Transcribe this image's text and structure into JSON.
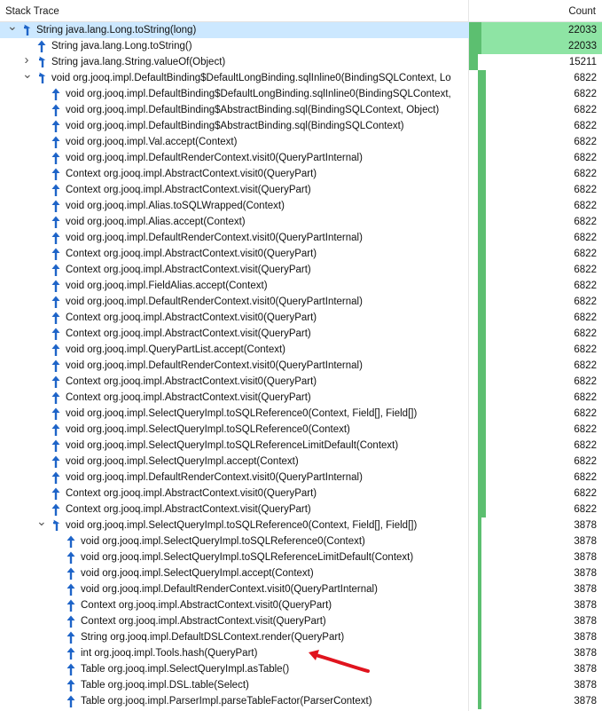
{
  "header": {
    "trace_label": "Stack Trace",
    "count_label": "Count"
  },
  "max_count": 22033,
  "colors": {
    "bar_dark": "#5cbf70",
    "bar_light": "#8ee4a4",
    "selected_row": "#cce8ff",
    "arrow_icon": "#1e64c8",
    "annotation": "#e0141e"
  },
  "rows": [
    {
      "depth": 0,
      "chevron": "down",
      "label": "String java.lang.Long.toString(long)",
      "count": "22033",
      "value": 22033,
      "icon": "arrow-up-left-icon",
      "selected": true
    },
    {
      "depth": 1,
      "chevron": "none",
      "label": "String java.lang.Long.toString()",
      "count": "22033",
      "value": 22033,
      "icon": "arrow-up-icon"
    },
    {
      "depth": 1,
      "chevron": "right",
      "label": "String java.lang.String.valueOf(Object)",
      "count": "15211",
      "value": 15211,
      "icon": "arrow-up-left-icon"
    },
    {
      "depth": 1,
      "chevron": "down",
      "label": "void org.jooq.impl.DefaultBinding$DefaultLongBinding.sqlInline0(BindingSQLContext, Lo",
      "count": "6822",
      "value": 6822,
      "icon": "arrow-up-left-icon"
    },
    {
      "depth": 2,
      "chevron": "none",
      "label": "void org.jooq.impl.DefaultBinding$DefaultLongBinding.sqlInline0(BindingSQLContext,",
      "count": "6822",
      "value": 6822,
      "icon": "arrow-up-icon"
    },
    {
      "depth": 2,
      "chevron": "none",
      "label": "void org.jooq.impl.DefaultBinding$AbstractBinding.sql(BindingSQLContext, Object)",
      "count": "6822",
      "value": 6822,
      "icon": "arrow-up-icon"
    },
    {
      "depth": 2,
      "chevron": "none",
      "label": "void org.jooq.impl.DefaultBinding$AbstractBinding.sql(BindingSQLContext)",
      "count": "6822",
      "value": 6822,
      "icon": "arrow-up-icon"
    },
    {
      "depth": 2,
      "chevron": "none",
      "label": "void org.jooq.impl.Val.accept(Context)",
      "count": "6822",
      "value": 6822,
      "icon": "arrow-up-icon"
    },
    {
      "depth": 2,
      "chevron": "none",
      "label": "void org.jooq.impl.DefaultRenderContext.visit0(QueryPartInternal)",
      "count": "6822",
      "value": 6822,
      "icon": "arrow-up-icon"
    },
    {
      "depth": 2,
      "chevron": "none",
      "label": "Context org.jooq.impl.AbstractContext.visit0(QueryPart)",
      "count": "6822",
      "value": 6822,
      "icon": "arrow-up-icon"
    },
    {
      "depth": 2,
      "chevron": "none",
      "label": "Context org.jooq.impl.AbstractContext.visit(QueryPart)",
      "count": "6822",
      "value": 6822,
      "icon": "arrow-up-icon"
    },
    {
      "depth": 2,
      "chevron": "none",
      "label": "void org.jooq.impl.Alias.toSQLWrapped(Context)",
      "count": "6822",
      "value": 6822,
      "icon": "arrow-up-icon"
    },
    {
      "depth": 2,
      "chevron": "none",
      "label": "void org.jooq.impl.Alias.accept(Context)",
      "count": "6822",
      "value": 6822,
      "icon": "arrow-up-icon"
    },
    {
      "depth": 2,
      "chevron": "none",
      "label": "void org.jooq.impl.DefaultRenderContext.visit0(QueryPartInternal)",
      "count": "6822",
      "value": 6822,
      "icon": "arrow-up-icon"
    },
    {
      "depth": 2,
      "chevron": "none",
      "label": "Context org.jooq.impl.AbstractContext.visit0(QueryPart)",
      "count": "6822",
      "value": 6822,
      "icon": "arrow-up-icon"
    },
    {
      "depth": 2,
      "chevron": "none",
      "label": "Context org.jooq.impl.AbstractContext.visit(QueryPart)",
      "count": "6822",
      "value": 6822,
      "icon": "arrow-up-icon"
    },
    {
      "depth": 2,
      "chevron": "none",
      "label": "void org.jooq.impl.FieldAlias.accept(Context)",
      "count": "6822",
      "value": 6822,
      "icon": "arrow-up-icon"
    },
    {
      "depth": 2,
      "chevron": "none",
      "label": "void org.jooq.impl.DefaultRenderContext.visit0(QueryPartInternal)",
      "count": "6822",
      "value": 6822,
      "icon": "arrow-up-icon"
    },
    {
      "depth": 2,
      "chevron": "none",
      "label": "Context org.jooq.impl.AbstractContext.visit0(QueryPart)",
      "count": "6822",
      "value": 6822,
      "icon": "arrow-up-icon"
    },
    {
      "depth": 2,
      "chevron": "none",
      "label": "Context org.jooq.impl.AbstractContext.visit(QueryPart)",
      "count": "6822",
      "value": 6822,
      "icon": "arrow-up-icon"
    },
    {
      "depth": 2,
      "chevron": "none",
      "label": "void org.jooq.impl.QueryPartList.accept(Context)",
      "count": "6822",
      "value": 6822,
      "icon": "arrow-up-icon"
    },
    {
      "depth": 2,
      "chevron": "none",
      "label": "void org.jooq.impl.DefaultRenderContext.visit0(QueryPartInternal)",
      "count": "6822",
      "value": 6822,
      "icon": "arrow-up-icon"
    },
    {
      "depth": 2,
      "chevron": "none",
      "label": "Context org.jooq.impl.AbstractContext.visit0(QueryPart)",
      "count": "6822",
      "value": 6822,
      "icon": "arrow-up-icon"
    },
    {
      "depth": 2,
      "chevron": "none",
      "label": "Context org.jooq.impl.AbstractContext.visit(QueryPart)",
      "count": "6822",
      "value": 6822,
      "icon": "arrow-up-icon"
    },
    {
      "depth": 2,
      "chevron": "none",
      "label": "void org.jooq.impl.SelectQueryImpl.toSQLReference0(Context, Field[], Field[])",
      "count": "6822",
      "value": 6822,
      "icon": "arrow-up-icon"
    },
    {
      "depth": 2,
      "chevron": "none",
      "label": "void org.jooq.impl.SelectQueryImpl.toSQLReference0(Context)",
      "count": "6822",
      "value": 6822,
      "icon": "arrow-up-icon"
    },
    {
      "depth": 2,
      "chevron": "none",
      "label": "void org.jooq.impl.SelectQueryImpl.toSQLReferenceLimitDefault(Context)",
      "count": "6822",
      "value": 6822,
      "icon": "arrow-up-icon"
    },
    {
      "depth": 2,
      "chevron": "none",
      "label": "void org.jooq.impl.SelectQueryImpl.accept(Context)",
      "count": "6822",
      "value": 6822,
      "icon": "arrow-up-icon"
    },
    {
      "depth": 2,
      "chevron": "none",
      "label": "void org.jooq.impl.DefaultRenderContext.visit0(QueryPartInternal)",
      "count": "6822",
      "value": 6822,
      "icon": "arrow-up-icon"
    },
    {
      "depth": 2,
      "chevron": "none",
      "label": "Context org.jooq.impl.AbstractContext.visit0(QueryPart)",
      "count": "6822",
      "value": 6822,
      "icon": "arrow-up-icon"
    },
    {
      "depth": 2,
      "chevron": "none",
      "label": "Context org.jooq.impl.AbstractContext.visit(QueryPart)",
      "count": "6822",
      "value": 6822,
      "icon": "arrow-up-icon"
    },
    {
      "depth": 2,
      "chevron": "down",
      "label": "void org.jooq.impl.SelectQueryImpl.toSQLReference0(Context, Field[], Field[])",
      "count": "3878",
      "value": 3878,
      "icon": "arrow-up-left-icon"
    },
    {
      "depth": 3,
      "chevron": "none",
      "label": "void org.jooq.impl.SelectQueryImpl.toSQLReference0(Context)",
      "count": "3878",
      "value": 3878,
      "icon": "arrow-up-icon"
    },
    {
      "depth": 3,
      "chevron": "none",
      "label": "void org.jooq.impl.SelectQueryImpl.toSQLReferenceLimitDefault(Context)",
      "count": "3878",
      "value": 3878,
      "icon": "arrow-up-icon"
    },
    {
      "depth": 3,
      "chevron": "none",
      "label": "void org.jooq.impl.SelectQueryImpl.accept(Context)",
      "count": "3878",
      "value": 3878,
      "icon": "arrow-up-icon"
    },
    {
      "depth": 3,
      "chevron": "none",
      "label": "void org.jooq.impl.DefaultRenderContext.visit0(QueryPartInternal)",
      "count": "3878",
      "value": 3878,
      "icon": "arrow-up-icon"
    },
    {
      "depth": 3,
      "chevron": "none",
      "label": "Context org.jooq.impl.AbstractContext.visit0(QueryPart)",
      "count": "3878",
      "value": 3878,
      "icon": "arrow-up-icon"
    },
    {
      "depth": 3,
      "chevron": "none",
      "label": "Context org.jooq.impl.AbstractContext.visit(QueryPart)",
      "count": "3878",
      "value": 3878,
      "icon": "arrow-up-icon"
    },
    {
      "depth": 3,
      "chevron": "none",
      "label": "String org.jooq.impl.DefaultDSLContext.render(QueryPart)",
      "count": "3878",
      "value": 3878,
      "icon": "arrow-up-icon"
    },
    {
      "depth": 3,
      "chevron": "none",
      "label": "int org.jooq.impl.Tools.hash(QueryPart)",
      "count": "3878",
      "value": 3878,
      "icon": "arrow-up-icon"
    },
    {
      "depth": 3,
      "chevron": "none",
      "label": "Table org.jooq.impl.SelectQueryImpl.asTable()",
      "count": "3878",
      "value": 3878,
      "icon": "arrow-up-icon"
    },
    {
      "depth": 3,
      "chevron": "none",
      "label": "Table org.jooq.impl.DSL.table(Select)",
      "count": "3878",
      "value": 3878,
      "icon": "arrow-up-icon"
    },
    {
      "depth": 3,
      "chevron": "none",
      "label": "Table org.jooq.impl.ParserImpl.parseTableFactor(ParserContext)",
      "count": "3878",
      "value": 3878,
      "icon": "arrow-up-icon"
    }
  ]
}
